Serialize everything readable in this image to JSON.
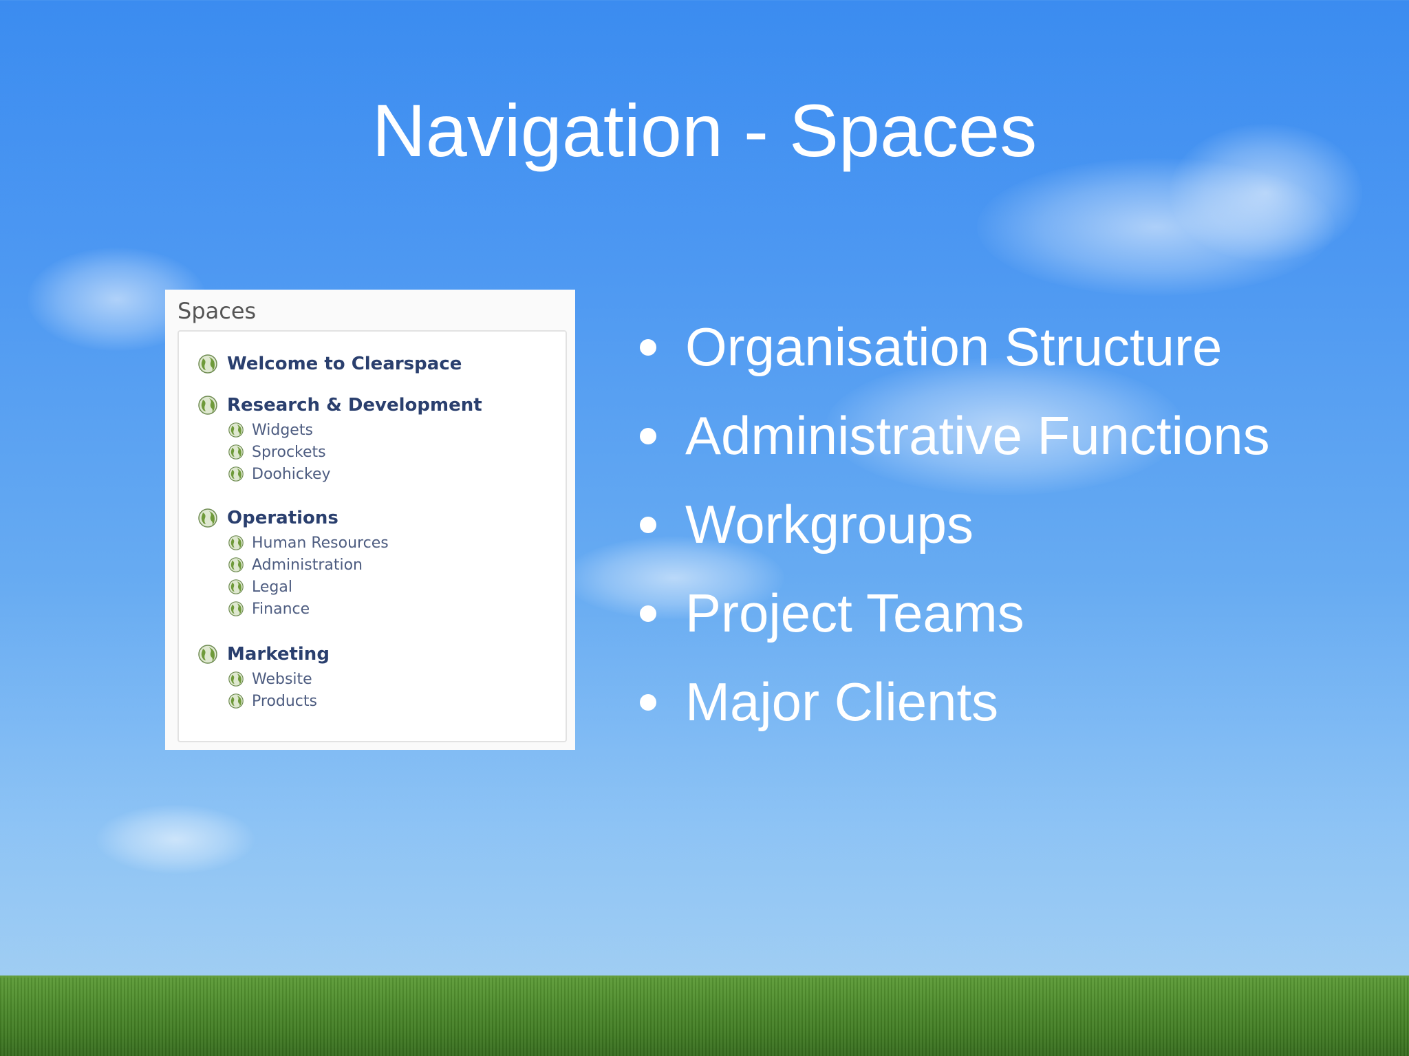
{
  "slide": {
    "title": "Navigation - Spaces"
  },
  "spaces_panel": {
    "title": "Spaces",
    "groups": [
      {
        "label": "Welcome to Clearspace",
        "children": []
      },
      {
        "label": "Research & Development",
        "children": [
          "Widgets",
          "Sprockets",
          "Doohickey"
        ]
      },
      {
        "label": "Operations",
        "children": [
          "Human Resources",
          "Administration",
          "Legal",
          "Finance"
        ]
      },
      {
        "label": "Marketing",
        "children": [
          "Website",
          "Products"
        ]
      }
    ]
  },
  "bullets": [
    "Organisation Structure",
    "Administrative Functions",
    "Workgroups",
    "Project Teams",
    "Major Clients"
  ],
  "colors": {
    "sky_top": "#3b8cf0",
    "sky_bottom": "#a8d2f2",
    "grass": "#4c8a2a",
    "link_bold": "#2a3f6e",
    "globe": "#6f9a3a"
  },
  "icons": {
    "space_icon": "globe-icon"
  }
}
